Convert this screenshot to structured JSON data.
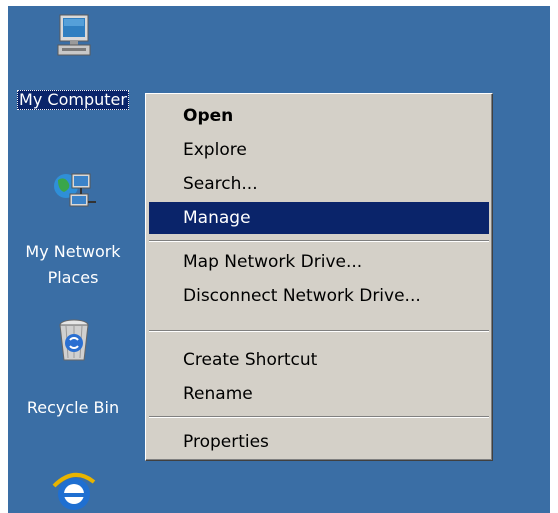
{
  "desktop": {
    "background_color": "#3a6ea5",
    "icons": [
      {
        "label": "My Computer",
        "icon": "my-computer-icon",
        "selected": true
      },
      {
        "label_line1": "My Network",
        "label_line2": "Places",
        "icon": "network-places-icon"
      },
      {
        "label": "Recycle Bin",
        "icon": "recycle-bin-icon"
      },
      {
        "icon": "internet-explorer-icon"
      }
    ]
  },
  "context_menu": {
    "items": [
      {
        "label": "Open",
        "default": true
      },
      {
        "label": "Explore"
      },
      {
        "label": "Search..."
      },
      {
        "label": "Manage",
        "highlighted": true
      },
      {
        "label": "Map Network Drive..."
      },
      {
        "label": "Disconnect Network Drive..."
      },
      {
        "label": "Create Shortcut"
      },
      {
        "label": "Rename"
      },
      {
        "label": "Properties"
      }
    ],
    "highlight_color": "#0a246a",
    "menu_color": "#d4d0c8"
  }
}
